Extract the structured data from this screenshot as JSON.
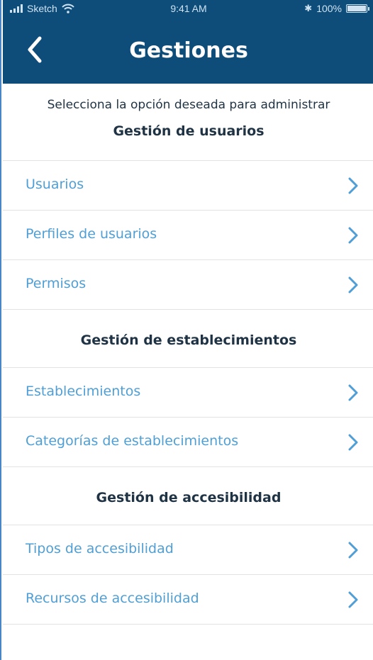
{
  "status_bar": {
    "carrier": "Sketch",
    "time": "9:41 AM",
    "bluetooth": "✱",
    "battery": "100%"
  },
  "header": {
    "title": "Gestiones",
    "back_icon": "chevron-left-icon"
  },
  "intro": "Selecciona la opción deseada para administrar",
  "sections": [
    {
      "heading": "Gestión de usuarios",
      "items": [
        {
          "label": "Usuarios"
        },
        {
          "label": "Perfiles de usuarios"
        },
        {
          "label": "Permisos"
        }
      ]
    },
    {
      "heading": "Gestión de establecimientos",
      "items": [
        {
          "label": "Establecimientos"
        },
        {
          "label": "Categorías de establecimientos"
        }
      ]
    },
    {
      "heading": "Gestión de accesibilidad",
      "items": [
        {
          "label": "Tipos de accesibilidad"
        },
        {
          "label": "Recursos de accesibilidad"
        }
      ]
    }
  ],
  "colors": {
    "header_bg": "#0e4c79",
    "link": "#4f9fd6",
    "heading": "#1f3344"
  }
}
